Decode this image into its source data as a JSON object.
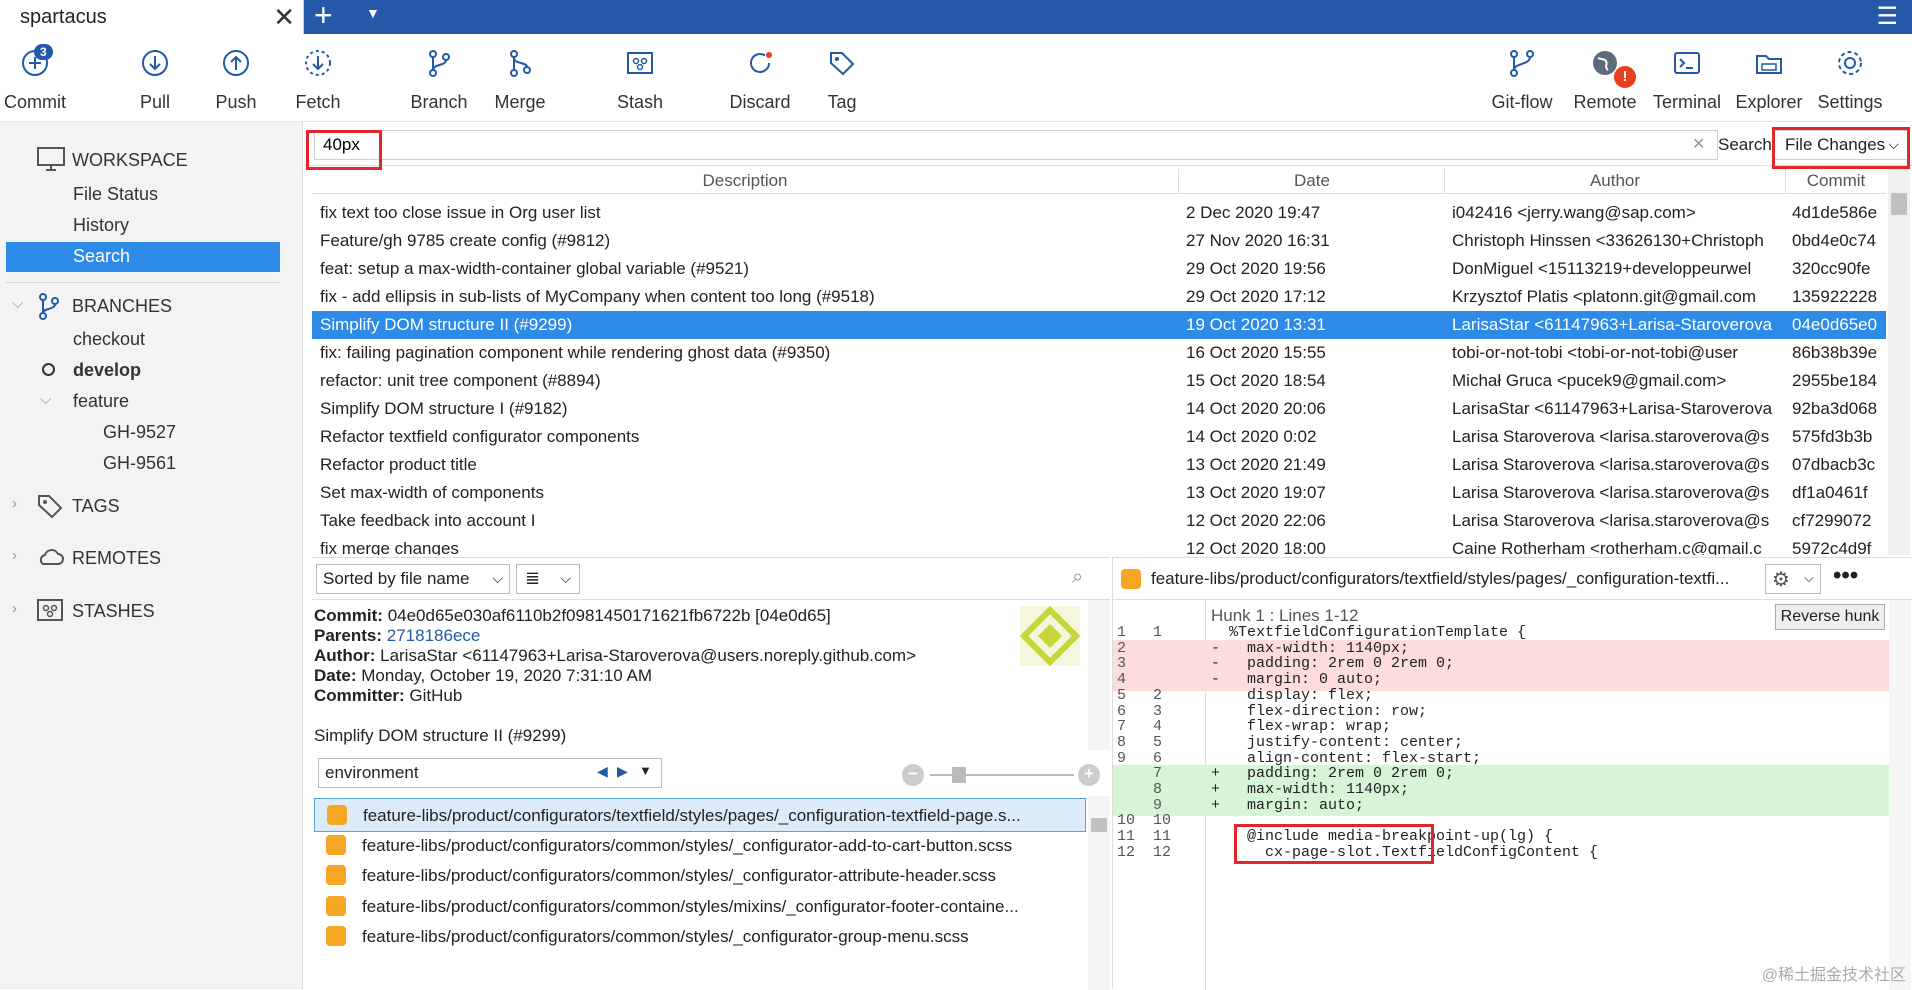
{
  "window": {
    "tab_title": "spartacus"
  },
  "toolbar": {
    "commit": "Commit",
    "commit_badge": "3",
    "pull": "Pull",
    "push": "Push",
    "fetch": "Fetch",
    "branch": "Branch",
    "merge": "Merge",
    "stash": "Stash",
    "discard": "Discard",
    "tag": "Tag",
    "gitflow": "Git-flow",
    "remote": "Remote",
    "remote_badge": "!",
    "terminal": "Terminal",
    "explorer": "Explorer",
    "settings": "Settings"
  },
  "sidebar": {
    "workspace": "WORKSPACE",
    "file_status": "File Status",
    "history": "History",
    "search": "Search",
    "branches": "BRANCHES",
    "checkout": "checkout",
    "develop": "develop",
    "feature": "feature",
    "gh9527": "GH-9527",
    "gh9561": "GH-9561",
    "tags": "TAGS",
    "remotes": "REMOTES",
    "stashes": "STASHES"
  },
  "search": {
    "query": "40px",
    "label": "Search:",
    "mode": "File Changes"
  },
  "columns": {
    "description": "Description",
    "date": "Date",
    "author": "Author",
    "commit": "Commit"
  },
  "commits": [
    {
      "desc": "fix text too close issue in Org user list",
      "date": "2 Dec 2020 19:47",
      "author": "i042416 <jerry.wang@sap.com>",
      "hash": "4d1de586e"
    },
    {
      "desc": "Feature/gh 9785 create config (#9812)",
      "date": "27 Nov 2020 16:31",
      "author": "Christoph Hinssen <33626130+Christoph",
      "hash": "0bd4e0c74"
    },
    {
      "desc": "feat: setup a max-width-container global variable (#9521)",
      "date": "29 Oct 2020 19:56",
      "author": "DonMiguel <15113219+developpeurwel",
      "hash": "320cc90fe"
    },
    {
      "desc": "fix - add ellipsis in sub-lists of MyCompany when content too long (#9518)",
      "date": "29 Oct 2020 17:12",
      "author": "Krzysztof Platis <platonn.git@gmail.com",
      "hash": "135922228"
    },
    {
      "desc": "Simplify DOM structure II (#9299)",
      "date": "19 Oct 2020 13:31",
      "author": "LarisaStar <61147963+Larisa-Staroverova",
      "hash": "04e0d65e0"
    },
    {
      "desc": "fix: failing pagination component while rendering ghost data (#9350)",
      "date": "16 Oct 2020 15:55",
      "author": "tobi-or-not-tobi <tobi-or-not-tobi@user",
      "hash": "86b38b39e"
    },
    {
      "desc": "refactor: unit tree component (#8894)",
      "date": "15 Oct 2020 18:54",
      "author": "Michał Gruca <pucek9@gmail.com>",
      "hash": "2955be184"
    },
    {
      "desc": "Simplify DOM structure I (#9182)",
      "date": "14 Oct 2020 20:06",
      "author": "LarisaStar <61147963+Larisa-Staroverova",
      "hash": "92ba3d068"
    },
    {
      "desc": "Refactor textfield configurator components",
      "date": "14 Oct 2020 0:02",
      "author": "Larisa Staroverova <larisa.staroverova@s",
      "hash": "575fd3b3b"
    },
    {
      "desc": "Refactor product title",
      "date": "13 Oct 2020 21:49",
      "author": "Larisa Staroverova <larisa.staroverova@s",
      "hash": "07dbacb3c"
    },
    {
      "desc": "Set max-width of components",
      "date": "13 Oct 2020 19:07",
      "author": "Larisa Staroverova <larisa.staroverova@s",
      "hash": "df1a0461f"
    },
    {
      "desc": "Take feedback into account I",
      "date": "12 Oct 2020 22:06",
      "author": "Larisa Staroverova <larisa.staroverova@s",
      "hash": "cf7299072"
    },
    {
      "desc": "fix merge changes",
      "date": "12 Oct 2020 18:00",
      "author": "Caine Rotherham <rotherham.c@gmail.c",
      "hash": "5972c4d9f"
    }
  ],
  "details": {
    "sort": "Sorted by file name",
    "commit_label": "Commit:",
    "commit_val": "04e0d65e030af6110b2f0981450171621fb6722b [04e0d65]",
    "parents_label": "Parents:",
    "parents_val": "2718186ece",
    "author_label": "Author:",
    "author_val": "LarisaStar <61147963+Larisa-Staroverova@users.noreply.github.com>",
    "date_label": "Date:",
    "date_val": "Monday, October 19, 2020 7:31:10 AM",
    "committer_label": "Committer:",
    "committer_val": "GitHub",
    "message": "Simplify DOM structure II (#9299)",
    "env": "environment"
  },
  "files": [
    "feature-libs/product/configurators/textfield/styles/pages/_configuration-textfield-page.s...",
    "feature-libs/product/configurators/common/styles/_configurator-add-to-cart-button.scss",
    "feature-libs/product/configurators/common/styles/_configurator-attribute-header.scss",
    "feature-libs/product/configurators/common/styles/mixins/_configurator-footer-containe...",
    "feature-libs/product/configurators/common/styles/_configurator-group-menu.scss"
  ],
  "diff": {
    "path": "feature-libs/product/configurators/textfield/styles/pages/_configuration-textfi...",
    "hunk": "Hunk 1 : Lines 1-12",
    "reverse": "Reverse hunk",
    "lines": [
      {
        "n1": "1",
        "n2": "1",
        "type": "ctx",
        "code": "  %TextfieldConfigurationTemplate {"
      },
      {
        "n1": "2",
        "n2": "",
        "type": "del",
        "code": "-   max-width: 1140px;"
      },
      {
        "n1": "3",
        "n2": "",
        "type": "del",
        "code": "-   padding: 2rem 0 2rem 0;"
      },
      {
        "n1": "4",
        "n2": "",
        "type": "del",
        "code": "-   margin: 0 auto;"
      },
      {
        "n1": "5",
        "n2": "2",
        "type": "ctx",
        "code": "    display: flex;"
      },
      {
        "n1": "6",
        "n2": "3",
        "type": "ctx",
        "code": "    flex-direction: row;"
      },
      {
        "n1": "7",
        "n2": "4",
        "type": "ctx",
        "code": "    flex-wrap: wrap;"
      },
      {
        "n1": "8",
        "n2": "5",
        "type": "ctx",
        "code": "    justify-content: center;"
      },
      {
        "n1": "9",
        "n2": "6",
        "type": "ctx",
        "code": "    align-content: flex-start;"
      },
      {
        "n1": "",
        "n2": "7",
        "type": "add",
        "code": "+   padding: 2rem 0 2rem 0;"
      },
      {
        "n1": "",
        "n2": "8",
        "type": "add",
        "code": "+   max-width: 1140px;"
      },
      {
        "n1": "",
        "n2": "9",
        "type": "add",
        "code": "+   margin: auto;"
      },
      {
        "n1": "10",
        "n2": "10",
        "type": "ctx",
        "code": ""
      },
      {
        "n1": "11",
        "n2": "11",
        "type": "ctx",
        "code": "    @include media-breakpoint-up(lg) {"
      },
      {
        "n1": "12",
        "n2": "12",
        "type": "ctx",
        "code": "      cx-page-slot.TextfieldConfigContent {"
      }
    ]
  },
  "watermark": "@稀土掘金技术社区"
}
